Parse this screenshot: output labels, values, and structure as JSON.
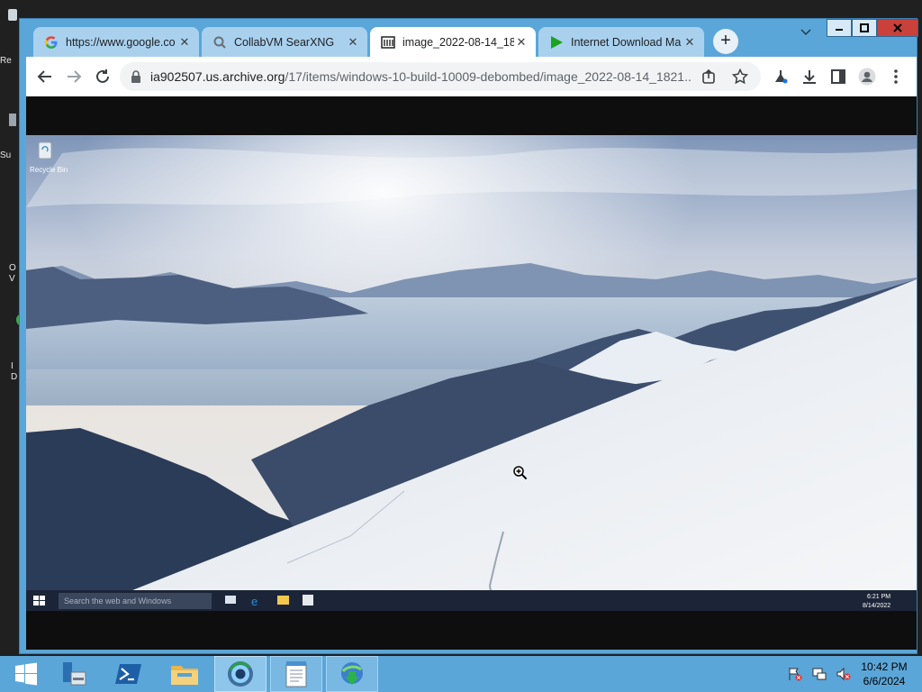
{
  "desktop": {
    "icons": [
      {
        "label": "Re"
      },
      {
        "label": "Su"
      },
      {
        "label": "O\nV"
      },
      {
        "label": "I\nD"
      }
    ]
  },
  "browser": {
    "tabs": [
      {
        "title": "https://www.google.co",
        "favicon": "google-g-icon",
        "active": false
      },
      {
        "title": "CollabVM SearXNG",
        "favicon": "searxng-icon",
        "active": false
      },
      {
        "title": "image_2022-08-14_18",
        "favicon": "archive-org-icon",
        "active": true
      },
      {
        "title": "Internet Download Ma",
        "favicon": "idm-play-icon",
        "active": false
      }
    ],
    "new_tab_label": "+",
    "address": {
      "host": "ia902507.us.archive.org",
      "path": "/17/items/windows-10-build-10009-debombed/image_2022-08-14_1821..."
    }
  },
  "inner_screenshot": {
    "recycle_bin_label": "Recycle Bin",
    "search_placeholder": "Search the web and Windows",
    "clock_time": "6:21 PM",
    "clock_date": "8/14/2022",
    "sky_top": "#7e95b8",
    "snow": "#f2f3f5"
  },
  "host_taskbar": {
    "apps": [
      "windows-start-icon",
      "server-manager-icon",
      "powershell-icon",
      "file-explorer-icon",
      "chrome-icon",
      "notepad-icon",
      "internet-download-manager-icon"
    ],
    "clock_time": "10:42 PM",
    "clock_date": "6/6/2024",
    "accent": "#5ba6d8"
  }
}
